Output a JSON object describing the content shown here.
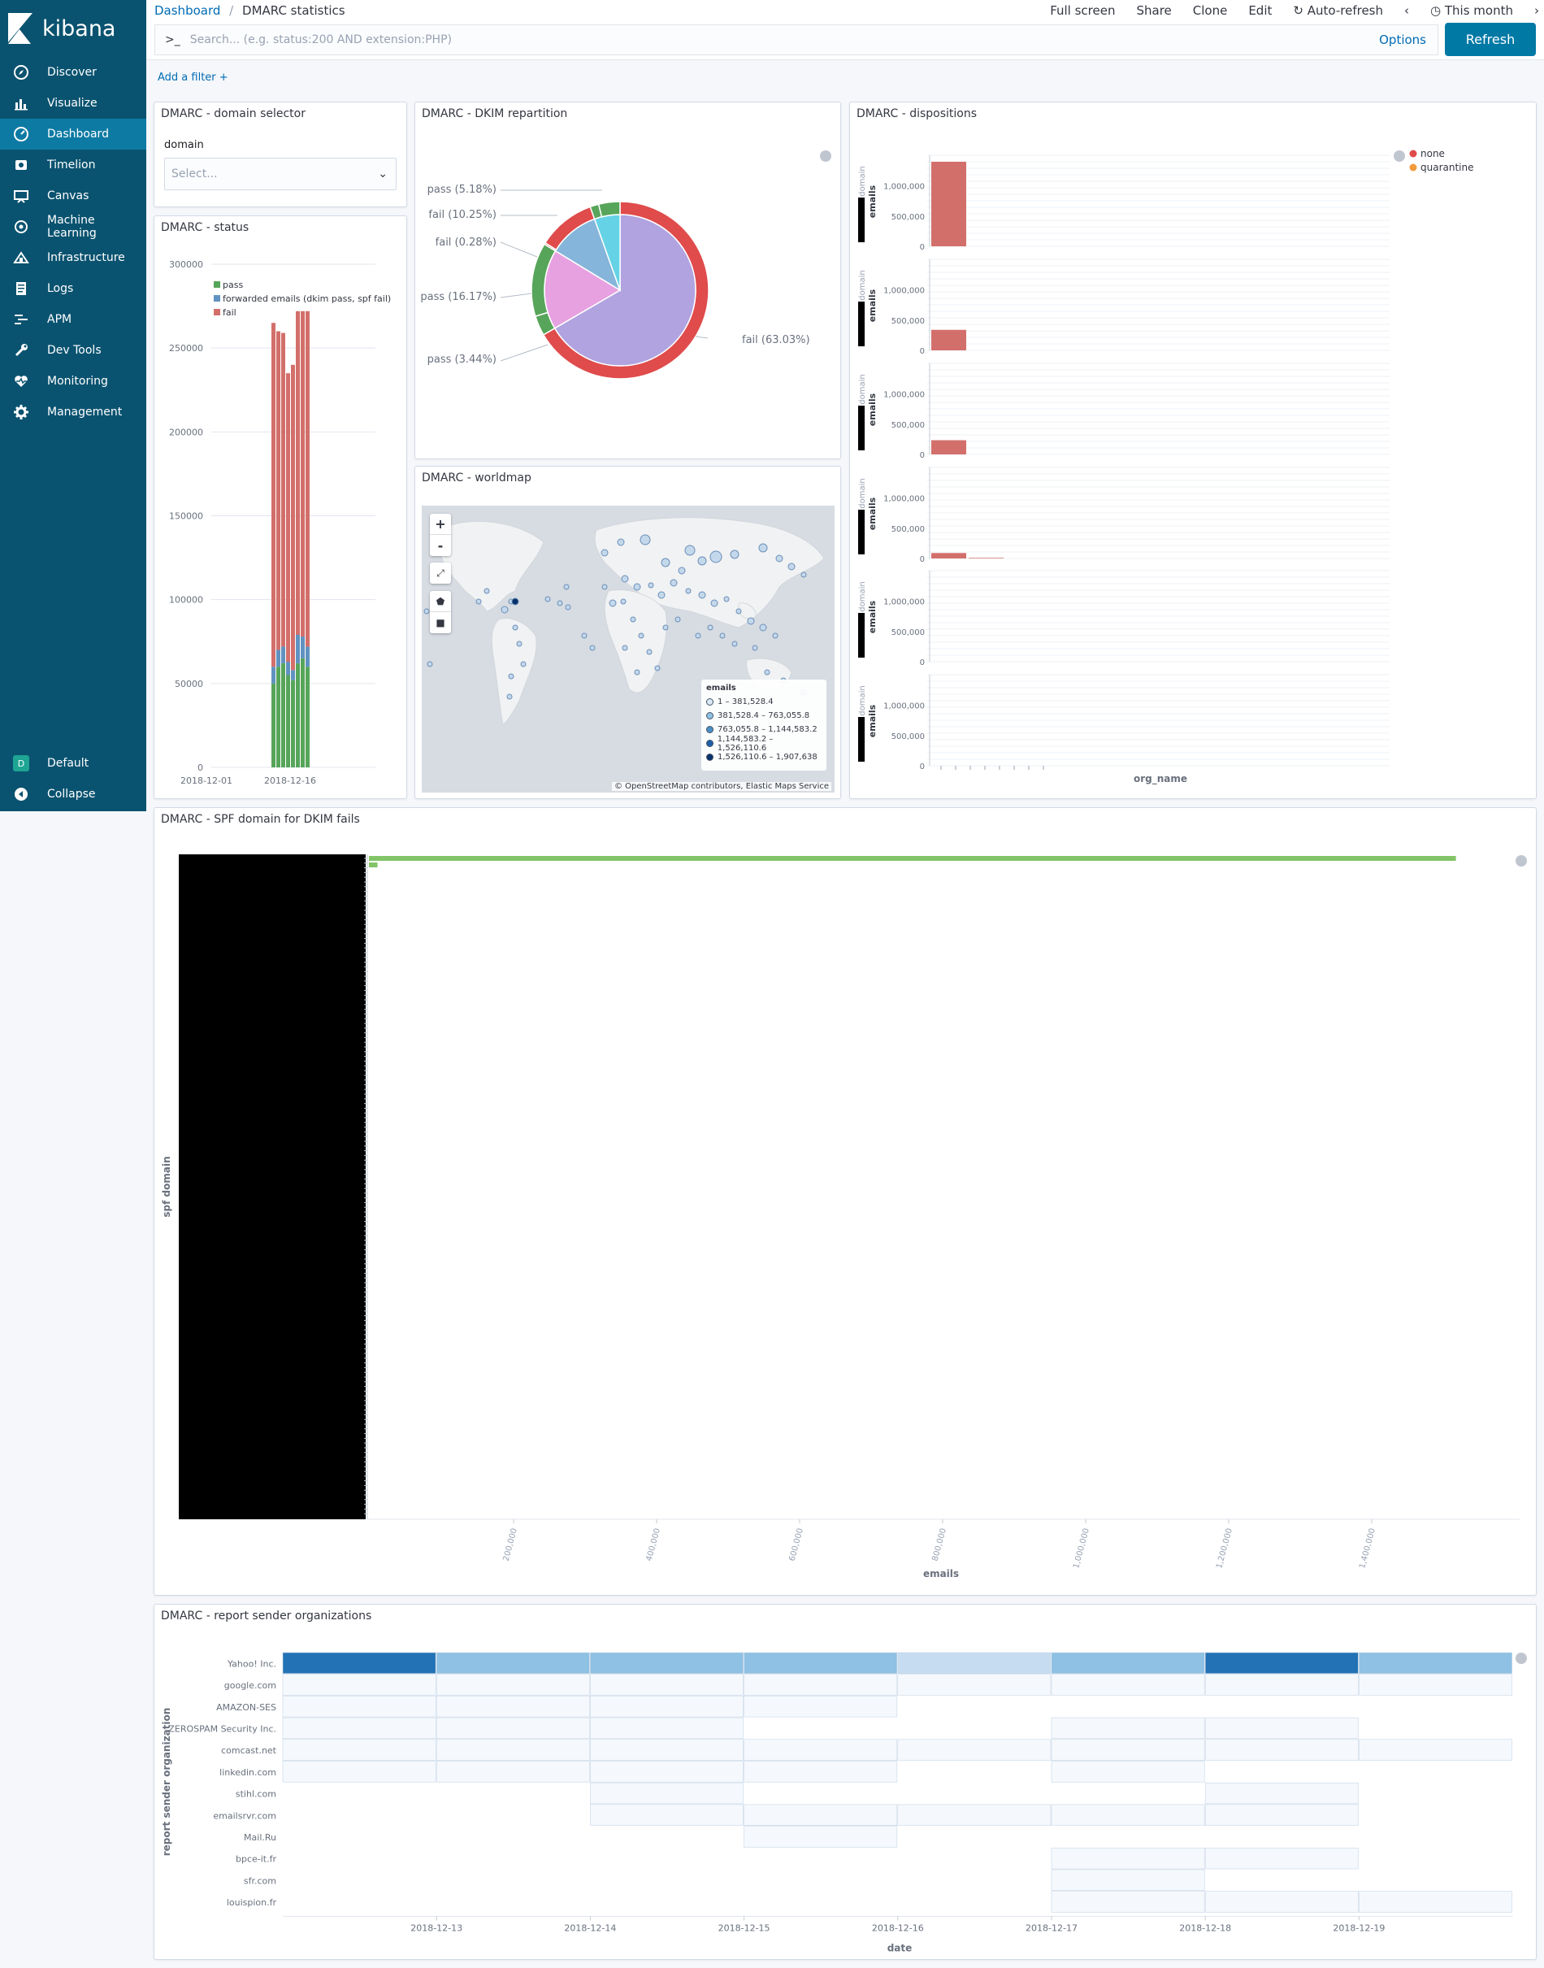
{
  "app": {
    "name": "kibana"
  },
  "nav": {
    "items": [
      {
        "label": "Discover"
      },
      {
        "label": "Visualize"
      },
      {
        "label": "Dashboard"
      },
      {
        "label": "Timelion"
      },
      {
        "label": "Canvas"
      },
      {
        "label": "Machine Learning"
      },
      {
        "label": "Infrastructure"
      },
      {
        "label": "Logs"
      },
      {
        "label": "APM"
      },
      {
        "label": "Dev Tools"
      },
      {
        "label": "Monitoring"
      },
      {
        "label": "Management"
      }
    ],
    "space": {
      "badge": "D",
      "label": "Default"
    },
    "collapse": "Collapse"
  },
  "breadcrumb": {
    "root": "Dashboard",
    "sep": "/",
    "current": "DMARC statistics"
  },
  "topmenu": {
    "fullscreen": "Full screen",
    "share": "Share",
    "clone": "Clone",
    "edit": "Edit",
    "autorefresh": "Auto-refresh",
    "timerange": "This month"
  },
  "search": {
    "prompt": ">_",
    "placeholder": "Search... (e.g. status:200 AND extension:PHP)",
    "options": "Options",
    "refresh": "Refresh"
  },
  "filter": {
    "add": "Add a filter +"
  },
  "panels": {
    "domain_selector": {
      "title": "DMARC - domain selector",
      "label": "domain",
      "placeholder": "Select..."
    },
    "status": {
      "title": "DMARC - status"
    },
    "dkim": {
      "title": "DMARC - DKIM repartition"
    },
    "worldmap": {
      "title": "DMARC - worldmap"
    },
    "dispositions": {
      "title": "DMARC - dispositions"
    },
    "spf": {
      "title": "DMARC - SPF domain for DKIM fails"
    },
    "orgs": {
      "title": "DMARC - report sender organizations"
    }
  },
  "map": {
    "zoom_in": "+",
    "zoom_out": "-",
    "legend_title": "emails",
    "legend": [
      "1 – 381,528.4",
      "381,528.4 – 763,055.8",
      "763,055.8 – 1,144,583.2",
      "1,144,583.2 – 1,526,110.6",
      "1,526,110.6 – 1,907,638"
    ],
    "legend_colors": [
      "#dbe9f6",
      "#8ec1e3",
      "#4a90c9",
      "#1e5fa8",
      "#08306b"
    ],
    "attribution_a": "© ",
    "attribution_link1": "OpenStreetMap",
    "attribution_b": " contributors, ",
    "attribution_link2": "Elastic Maps Service"
  },
  "chart_data": [
    {
      "id": "status",
      "type": "bar",
      "stacked": true,
      "ylim": [
        0,
        300000
      ],
      "yticks": [
        "0",
        "50000",
        "100000",
        "150000",
        "200000",
        "250000",
        "300000"
      ],
      "xticks": [
        "2018-12-01",
        "2018-12-16"
      ],
      "legend": [
        "pass",
        "forwarded emails (dkim pass, spf fail)",
        "fail"
      ],
      "colors": {
        "pass": "#57a55a",
        "forwarded": "#6092c0",
        "fail": "#d36f6b"
      },
      "series": [
        {
          "name": "pass",
          "values": [
            50000,
            60000,
            62000,
            55000,
            52000,
            62000,
            65000,
            60000
          ]
        },
        {
          "name": "forwarded emails (dkim pass, spf fail)",
          "values": [
            10000,
            10000,
            10000,
            8000,
            6000,
            17000,
            13000,
            12000
          ]
        },
        {
          "name": "fail",
          "values": [
            205000,
            190000,
            187000,
            172000,
            182000,
            193000,
            194000,
            200000
          ]
        }
      ]
    },
    {
      "id": "dkim",
      "type": "pie",
      "inner": [
        {
          "label": "fail (63.03%)",
          "value": 63.03,
          "color": "#b0a3e0"
        },
        {
          "label": "pass (16.17%)",
          "value": 16.17,
          "color": "#e7a1e0"
        },
        {
          "label": "fail (10.25%)",
          "value": 10.25,
          "color": "#85b5da"
        },
        {
          "label": "pass (5.18%)",
          "value": 5.18,
          "color": "#66d2e5"
        }
      ],
      "outer": [
        {
          "label": "fail (63.03%)",
          "value": 63.03,
          "color": "#e04b4b"
        },
        {
          "label": "pass (3.44%)",
          "value": 3.44,
          "color": "#57a55a"
        },
        {
          "label": "pass (16.17%)",
          "value": 12.73,
          "color": "#57a55a"
        },
        {
          "label": "fail (0.28%)",
          "value": 0.28,
          "color": "#e04b4b"
        },
        {
          "label": "fail (10.25%)",
          "value": 9.97,
          "color": "#e04b4b"
        },
        {
          "label": "pass (5.18%)",
          "value": 1.5,
          "color": "#57a55a"
        },
        {
          "label": "",
          "value": 3.68,
          "color": "#57a55a"
        }
      ]
    },
    {
      "id": "dispositions",
      "type": "bar",
      "facet_count": 6,
      "yticks": [
        "0",
        "500,000",
        "1,000,000"
      ],
      "ylabel": "emails",
      "facet_label": "domain",
      "xlabel": "org_name",
      "legend": [
        "none",
        "quarantine"
      ],
      "colors": {
        "none": "#d36f6b",
        "quarantine": "#f29b3c"
      },
      "facets": [
        {
          "none": [
            1400000
          ]
        },
        {
          "none": [
            340000
          ]
        },
        {
          "none": [
            235000
          ]
        },
        {
          "none": [
            90000,
            10000
          ]
        },
        {
          "none": [
            0
          ]
        },
        {
          "none": [
            0
          ]
        }
      ]
    },
    {
      "id": "spf",
      "type": "bar",
      "orientation": "horizontal",
      "ylabel": "spf domain",
      "xlabel": "emails",
      "xticks": [
        "200,000",
        "400,000",
        "600,000",
        "800,000",
        "1,000,000",
        "1,200,000",
        "1,400,000"
      ],
      "values": [
        1520000,
        12000
      ],
      "color": "#82c468"
    },
    {
      "id": "orgs",
      "type": "heatmap",
      "ylabel": "report sender organization",
      "xlabel": "date",
      "xticks": [
        "2018-12-13",
        "2018-12-14",
        "2018-12-15",
        "2018-12-16",
        "2018-12-17",
        "2018-12-18",
        "2018-12-19"
      ],
      "rows": [
        "Yahoo! Inc.",
        "google.com",
        "AMAZON-SES",
        "ZEROSPAM Security Inc.",
        "comcast.net",
        "linkedin.com",
        "stihl.com",
        "emailsrvr.com",
        "Mail.Ru",
        "bpce-it.fr",
        "sfr.com",
        "louispion.fr"
      ],
      "cells": [
        [
          5,
          3,
          3,
          3,
          2,
          3,
          5,
          3
        ],
        [
          1,
          1,
          1,
          1,
          1,
          1,
          1,
          1
        ],
        [
          1,
          1,
          1,
          1,
          0,
          0,
          0,
          0
        ],
        [
          1,
          1,
          1,
          0,
          0,
          1,
          1,
          0
        ],
        [
          1,
          1,
          1,
          1,
          1,
          1,
          1,
          1
        ],
        [
          1,
          1,
          1,
          1,
          0,
          1,
          0,
          0
        ],
        [
          0,
          0,
          1,
          0,
          0,
          0,
          1,
          0
        ],
        [
          0,
          0,
          1,
          1,
          1,
          1,
          1,
          0
        ],
        [
          0,
          0,
          0,
          1,
          0,
          0,
          0,
          0
        ],
        [
          0,
          0,
          0,
          0,
          0,
          1,
          1,
          0
        ],
        [
          0,
          0,
          0,
          0,
          0,
          1,
          0,
          0
        ],
        [
          0,
          0,
          0,
          0,
          0,
          1,
          1,
          1
        ]
      ],
      "palette": [
        "none",
        "#f5f9fd",
        "#c6dcf0",
        "#8ec1e3",
        "#5aa1d6",
        "#2272b5"
      ]
    }
  ]
}
